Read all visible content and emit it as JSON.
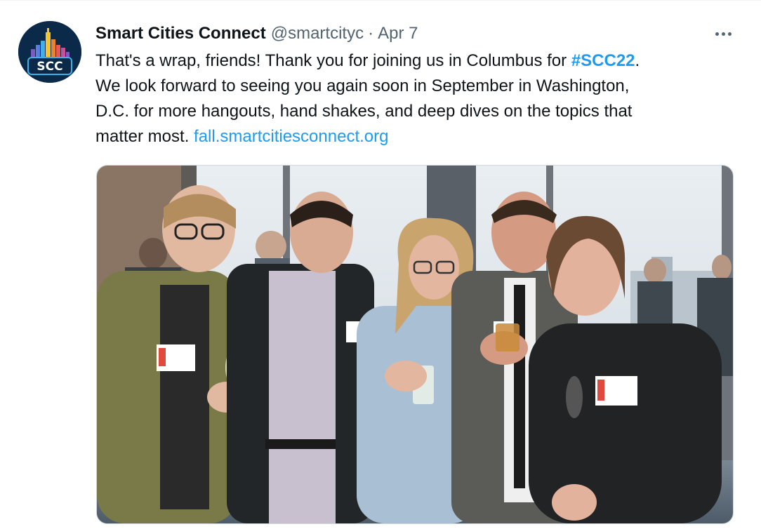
{
  "tweet": {
    "author": {
      "display_name": "Smart Cities Connect",
      "handle": "@smartcityc",
      "avatar_text": "SCC",
      "avatar_icon": "city-skyline-logo-icon"
    },
    "separator": "·",
    "date": "Apr 7",
    "more_icon": "more-horizontal-icon",
    "text": {
      "line1_prefix": "That's a wrap, friends! Thank you for joining us in Columbus for ",
      "hashtag": "#SCC22",
      "line1_suffix": ".",
      "line2": "We look forward to seeing you again soon in September in Washington,",
      "line3": "D.C. for more hangouts, hand shakes, and deep dives on the topics that",
      "line4_prefix": "matter most. ",
      "link": "fall.smartcitiesconnect.org"
    },
    "media": {
      "type": "photo",
      "description_icon": "group-photo-image"
    }
  },
  "colors": {
    "text_primary": "#0f1419",
    "text_secondary": "#536471",
    "link": "#1d9bf0",
    "avatar_bg": "#0b2a4a",
    "border": "#cfd9de"
  }
}
